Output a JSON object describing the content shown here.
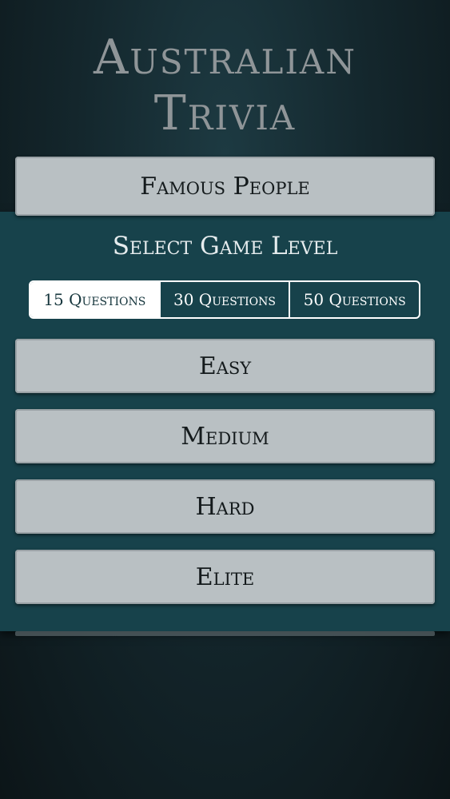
{
  "header": {
    "title_line1": "Australian",
    "title_line2": "Trivia"
  },
  "category": {
    "label": "Famous People"
  },
  "level_panel": {
    "title": "Select Game Level",
    "question_counts": [
      {
        "label": "15 Questions",
        "selected": true
      },
      {
        "label": "30 Questions",
        "selected": false
      },
      {
        "label": "50 Questions",
        "selected": false
      }
    ],
    "levels": [
      {
        "label": "Easy"
      },
      {
        "label": "Medium"
      },
      {
        "label": "Hard"
      },
      {
        "label": "Elite"
      }
    ]
  },
  "colors": {
    "background": "#14272d",
    "panel": "#17424b",
    "button": "#b9c0c3",
    "title_text": "#8f9598",
    "segment_border": "#ffffff"
  }
}
